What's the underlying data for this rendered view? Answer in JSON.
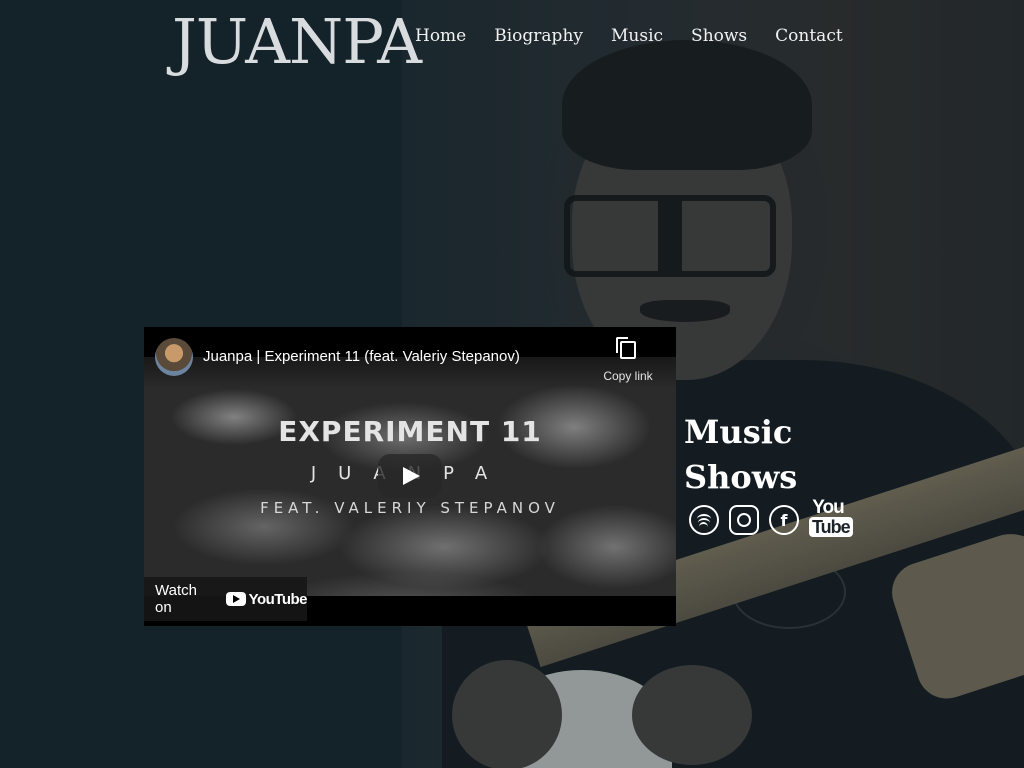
{
  "site": {
    "logo_text": "JUANPA"
  },
  "nav": {
    "items": [
      {
        "label": "Home"
      },
      {
        "label": "Biography"
      },
      {
        "label": "Music"
      },
      {
        "label": "Shows"
      },
      {
        "label": "Contact"
      }
    ]
  },
  "video": {
    "title": "Juanpa | Experiment 11 (feat. Valeriy Stepanov)",
    "copy_link_label": "Copy link",
    "thumbnail": {
      "headline": "EXPERIMENT 11",
      "artist": "JUANPA",
      "feature": "FEAT. VALERIY STEPANOV"
    },
    "watch_on_label": "Watch on",
    "youtube_wordmark": "YouTube"
  },
  "side_links": [
    {
      "label": "Music"
    },
    {
      "label": "Shows"
    }
  ],
  "socials": {
    "items": [
      {
        "icon": "spotify-icon"
      },
      {
        "icon": "instagram-icon"
      },
      {
        "icon": "facebook-icon",
        "glyph": "f"
      },
      {
        "icon": "youtube-icon",
        "top": "You",
        "bottom": "Tube"
      }
    ]
  }
}
